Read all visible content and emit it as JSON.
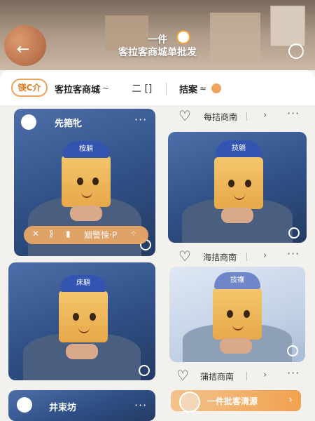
{
  "header": {
    "title_line1": "一件",
    "title_line2": "客拉客商城单批发"
  },
  "tabs": {
    "shop_badge": "镁C介",
    "shop_name": "客拉客商城",
    "shop_wave": "~",
    "mid_icon": "二 []",
    "search": "拮案",
    "search_sub": "≈"
  },
  "cards": {
    "left1": {
      "title": "先筢牝",
      "more": "···",
      "cap_text": "桉躺",
      "action_bar": {
        "icons": [
          "✕",
          "⟫",
          "▮"
        ],
        "label": "婟警悚·P",
        "extra": "⁘"
      }
    },
    "left2": {
      "cap_text": "床躺"
    },
    "left3": {
      "title": "井束坊"
    },
    "right1": {
      "label": "每拮商南",
      "cap_text": "技躺"
    },
    "right2": {
      "label": "海拮商南",
      "cap_text": "技禳"
    },
    "right3": {
      "label": "蒲拮商南"
    }
  },
  "banner": {
    "label": "一件批客清源",
    "arrow": "›"
  },
  "colors": {
    "accent": "#f0a35a",
    "accent_dark": "#e47b25",
    "photo_blue": "#2f4f86"
  }
}
